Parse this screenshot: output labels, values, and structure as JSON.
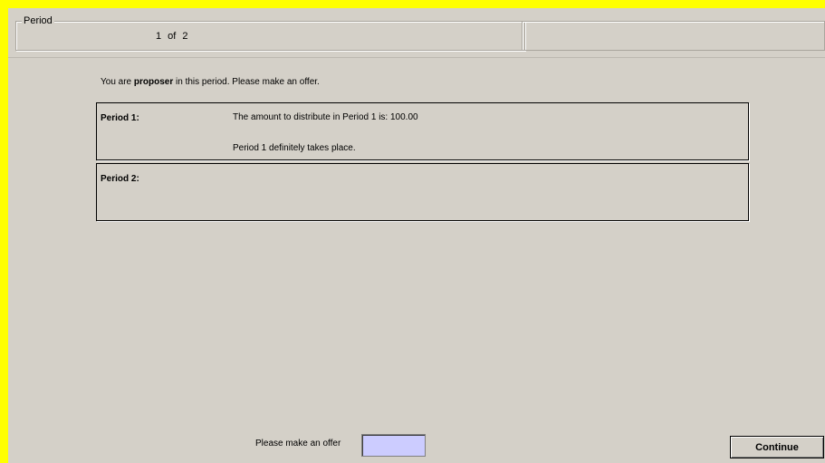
{
  "header": {
    "period_legend": "Period",
    "period_value": "1 of 2"
  },
  "main": {
    "instruction_prefix": "You are ",
    "instruction_role": "proposer",
    "instruction_suffix": " in this period. Please make an offer.",
    "periods": [
      {
        "label": "Period 1:",
        "amount_text": "The amount to distribute in Period 1 is: 100.00",
        "status_text": "Period 1 definitely takes place."
      },
      {
        "label": "Period 2:",
        "amount_text": "",
        "status_text": ""
      }
    ]
  },
  "footer": {
    "offer_label": "Please make an offer",
    "offer_value": "",
    "continue_label": "Continue"
  },
  "colors": {
    "frame": "#ffff00",
    "panel": "#d4d0c8",
    "input_bg": "#ccccff"
  }
}
